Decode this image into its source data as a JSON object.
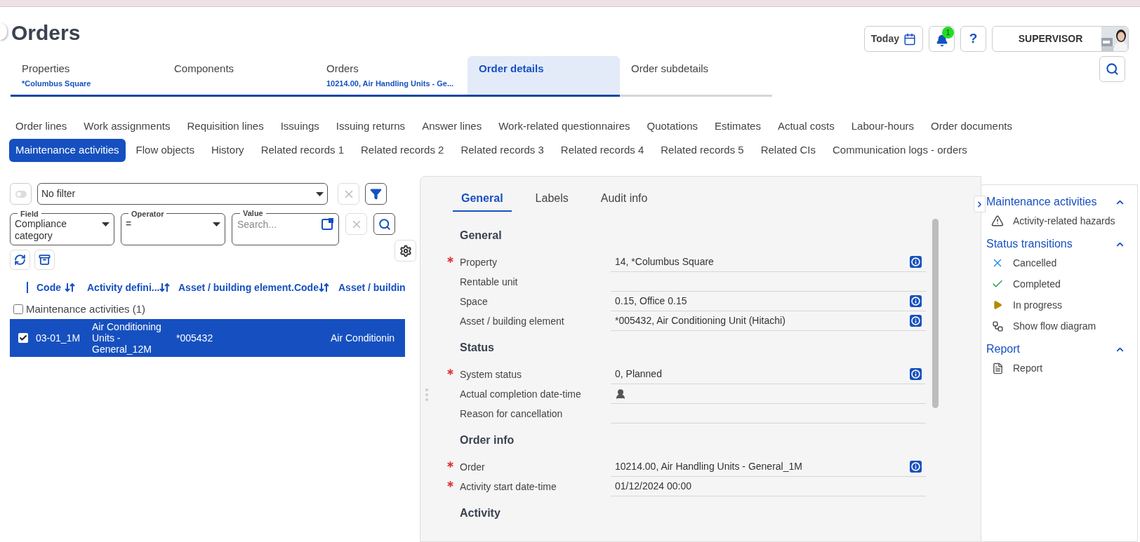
{
  "page": {
    "title": "Orders"
  },
  "header": {
    "today_label": "Today",
    "notification_count": "1",
    "help_label": "?",
    "user_label": "SUPERVISOR"
  },
  "main_tabs": [
    {
      "label": "Properties",
      "subtitle": "*Columbus Square",
      "selected": false
    },
    {
      "label": "Components",
      "selected": false
    },
    {
      "label": "Orders",
      "subtitle": "10214.00, Air Handling Units - Ge...",
      "selected": false
    },
    {
      "label": "Order details",
      "selected": true
    },
    {
      "label": "Order subdetails",
      "selected": false
    }
  ],
  "sub_tabs": [
    [
      {
        "label": "Order lines",
        "selected": false
      },
      {
        "label": "Work assignments",
        "selected": false
      },
      {
        "label": "Requisition lines",
        "selected": false
      },
      {
        "label": "Issuings",
        "selected": false
      },
      {
        "label": "Issuing returns",
        "selected": false
      },
      {
        "label": "Answer lines",
        "selected": false
      },
      {
        "label": "Work-related questionnaires",
        "selected": false
      },
      {
        "label": "Quotations",
        "selected": false
      },
      {
        "label": "Estimates",
        "selected": false
      },
      {
        "label": "Actual costs",
        "selected": false
      },
      {
        "label": "Labour-hours",
        "selected": false
      },
      {
        "label": "Order documents",
        "selected": false
      }
    ],
    [
      {
        "label": "Maintenance activities",
        "selected": true
      },
      {
        "label": "Flow objects",
        "selected": false
      },
      {
        "label": "History",
        "selected": false
      },
      {
        "label": "Related records 1",
        "selected": false
      },
      {
        "label": "Related records 2",
        "selected": false
      },
      {
        "label": "Related records 3",
        "selected": false
      },
      {
        "label": "Related records 4",
        "selected": false
      },
      {
        "label": "Related records 5",
        "selected": false
      },
      {
        "label": "Related CIs",
        "selected": false
      },
      {
        "label": "Communication logs - orders",
        "selected": false
      }
    ]
  ],
  "filter": {
    "value": "No filter",
    "toggle_on": false,
    "field": {
      "label": "Field",
      "value": "Compliance category"
    },
    "operator": {
      "label": "Operator",
      "value": "="
    },
    "value_field": {
      "label": "Value",
      "placeholder": "Search..."
    }
  },
  "table": {
    "columns": [
      {
        "label": "Code",
        "sortable": true
      },
      {
        "label": "Activity defini...",
        "sortable": true
      },
      {
        "label": "Asset / building element.Code",
        "sortable": true
      },
      {
        "label": "Asset / buildin",
        "sortable": false
      }
    ],
    "group": {
      "label": "Maintenance activities (1)",
      "checked": false
    },
    "rows": [
      {
        "selected": true,
        "checked": true,
        "cells": [
          "03-01_1M",
          "Air Conditioning Units - General_12M",
          "*005432",
          "Air Conditionin"
        ]
      }
    ]
  },
  "details": {
    "tabs": [
      {
        "label": "General",
        "selected": true
      },
      {
        "label": "Labels",
        "selected": false
      },
      {
        "label": "Audit info",
        "selected": false
      }
    ],
    "sections": [
      {
        "title": "General",
        "fields": [
          {
            "label": "Property",
            "required": true,
            "value": "14, *Columbus Square",
            "info": true,
            "kind": "text"
          },
          {
            "label": "Rentable unit",
            "required": false,
            "info": false,
            "kind": "text"
          },
          {
            "label": "Space",
            "required": false,
            "value": "0.15, Office 0.15",
            "info": true,
            "kind": "text"
          },
          {
            "label": "Asset / building element",
            "required": false,
            "value": "*005432, Air Conditioning Unit (Hitachi)",
            "info": true,
            "kind": "text"
          }
        ]
      },
      {
        "title": "Status",
        "fields": [
          {
            "label": "System status",
            "required": true,
            "value": "0, Planned",
            "info": true,
            "kind": "text"
          },
          {
            "label": "Actual completion date-time",
            "required": false,
            "info": false,
            "kind": "person"
          },
          {
            "label": "Reason for cancellation",
            "required": false,
            "info": false,
            "kind": "text"
          }
        ]
      },
      {
        "title": "Order info",
        "fields": [
          {
            "label": "Order",
            "required": true,
            "value": "10214.00, Air Handling Units - General_1M",
            "info": true,
            "kind": "text"
          },
          {
            "label": "Activity start date-time",
            "required": true,
            "value": "01/12/2024 00:00",
            "info": false,
            "kind": "text"
          }
        ]
      },
      {
        "title": "Activity"
      }
    ]
  },
  "actions": [
    {
      "title": "Maintenance activities",
      "expanded": true,
      "items": [
        {
          "label": "Activity-related hazards",
          "kind": "hazard"
        }
      ]
    },
    {
      "title": "Status transitions",
      "expanded": true,
      "items": [
        {
          "label": "Cancelled",
          "kind": "cancel"
        },
        {
          "label": "Completed",
          "kind": "complete"
        },
        {
          "label": "In progress",
          "kind": "progress"
        },
        {
          "label": "Show flow diagram",
          "kind": "flow"
        }
      ]
    },
    {
      "title": "Report",
      "expanded": true,
      "items": [
        {
          "label": "Report",
          "kind": "report"
        }
      ]
    }
  ]
}
